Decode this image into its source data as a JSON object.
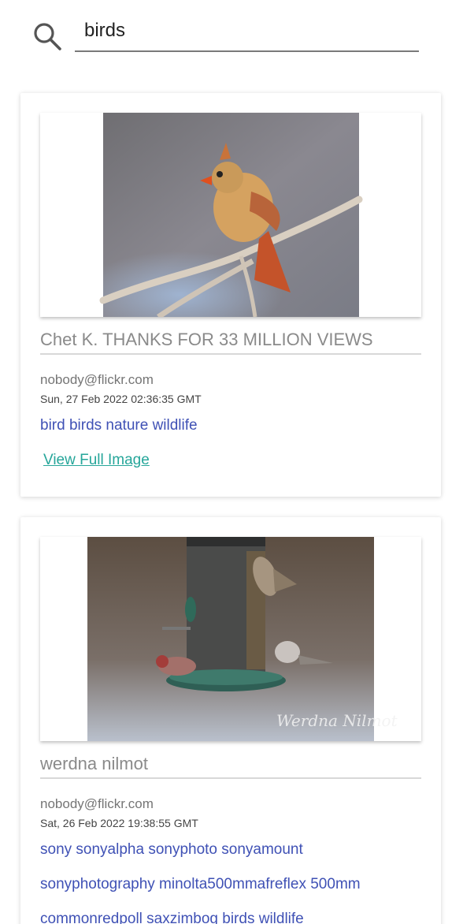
{
  "search": {
    "value": "birds"
  },
  "results": [
    {
      "image_subject": "female cardinal on branch",
      "title": "Chet K. THANKS FOR 33 MILLION VIEWS",
      "author": "nobody@flickr.com",
      "date": "Sun, 27 Feb 2022 02:36:35 GMT",
      "tags": "bird birds nature wildlife",
      "link_label": "View Full Image"
    },
    {
      "image_subject": "redpolls at bird feeder",
      "watermark": "Werdna Nilmot",
      "title": "werdna nilmot",
      "author": "nobody@flickr.com",
      "date": "Sat, 26 Feb 2022 19:38:55 GMT",
      "tags_lines": [
        "sony sonyalpha sonyphoto sonyamount",
        "sonyphotography minolta500mmafreflex 500mm",
        "commonredpoll saxzimbog birds wildlife"
      ]
    }
  ],
  "colors": {
    "accent_tag": "#3f51b5",
    "link": "#26a69a",
    "title": "#8a8a8a"
  }
}
